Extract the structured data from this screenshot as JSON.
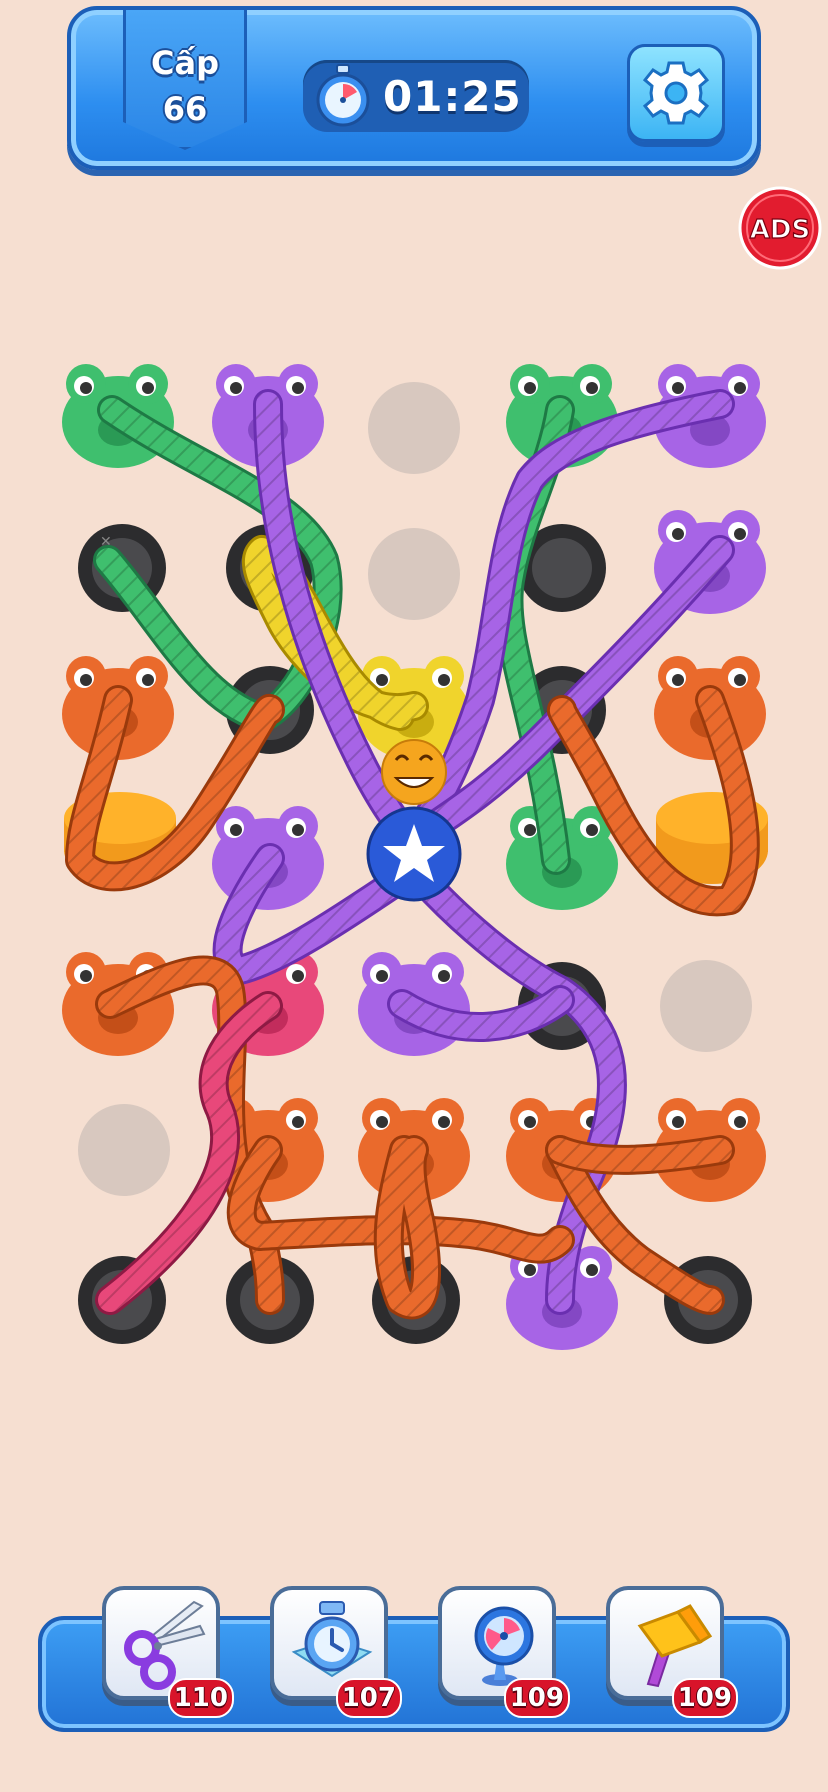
{
  "hud": {
    "level_label": "Cấp",
    "level_number": "66",
    "timer": "01:25"
  },
  "ads_label": "ADS",
  "boosters": [
    {
      "name": "scissors-icon",
      "count": "110"
    },
    {
      "name": "stopwatch-icon",
      "count": "107"
    },
    {
      "name": "fan-icon",
      "count": "109"
    },
    {
      "name": "hammer-icon",
      "count": "109"
    }
  ],
  "colors": {
    "background": "#f6dfd1",
    "green": "#3fbf6e",
    "purple": "#a764e6",
    "orange": "#ea6a2c",
    "yellow": "#f0d42c",
    "pink": "#e8487a",
    "hud_blue": "#2d8ef0",
    "badge_red": "#d8142a"
  },
  "board": {
    "frogs": [
      {
        "id": "frog-green-r1c1",
        "color": "green"
      },
      {
        "id": "frog-purple-r1c2",
        "color": "purple"
      },
      {
        "id": "frog-green-r1c4",
        "color": "green"
      },
      {
        "id": "frog-purple-r1c5",
        "color": "purple"
      },
      {
        "id": "frog-purple-r2c5",
        "color": "purple"
      },
      {
        "id": "frog-orange-r3c1",
        "color": "orange"
      },
      {
        "id": "frog-yellow-r3c3",
        "color": "yellow"
      },
      {
        "id": "frog-orange-r3c5",
        "color": "orange"
      },
      {
        "id": "frog-purple-r4c2",
        "color": "purple"
      },
      {
        "id": "frog-green-r4c4",
        "color": "green"
      },
      {
        "id": "frog-orange-r5c1",
        "color": "orange"
      },
      {
        "id": "frog-pink-r5c2",
        "color": "pink"
      },
      {
        "id": "frog-purple-r5c3",
        "color": "purple"
      },
      {
        "id": "frog-orange-r6c2",
        "color": "orange"
      },
      {
        "id": "frog-orange-r6c3",
        "color": "orange"
      },
      {
        "id": "frog-orange-r6c4",
        "color": "orange"
      },
      {
        "id": "frog-orange-r6c5",
        "color": "orange"
      },
      {
        "id": "frog-purple-r7c4",
        "color": "purple"
      }
    ]
  }
}
